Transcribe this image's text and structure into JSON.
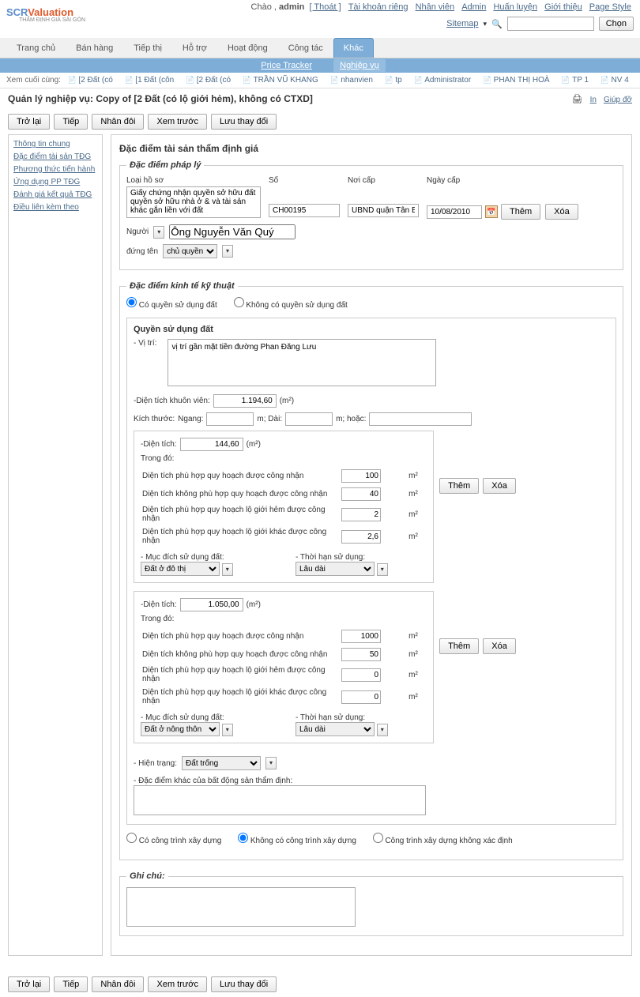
{
  "logo": {
    "part1": "SCR",
    "part2": "Valuation",
    "sub": "THẨM ĐỊNH GIÁ SÀI GÒN"
  },
  "top": {
    "greeting": "Chào , ",
    "user": "admin",
    "logout": "[ Thoát ]",
    "links": [
      "Tài khoản riêng",
      "Nhân viên",
      "Admin",
      "Huấn luyện",
      "Giới thiệu",
      "Page Style"
    ],
    "sitemap": "Sitemap",
    "search_btn": "Chọn"
  },
  "nav": [
    "Trang chủ",
    "Bán hàng",
    "Tiếp thị",
    "Hỗ trợ",
    "Hoạt động",
    "Công tác",
    "Khác"
  ],
  "subnav": [
    "Price Tracker",
    "Nghiệp vụ"
  ],
  "recents": {
    "label": "Xem cuối cùng:",
    "items": [
      "[2 Đất (có",
      "[1 Đất (côn",
      "[2 Đất (có",
      "TRẦN VŨ KHANG",
      "nhanvien",
      "tp",
      "Administrator",
      "PHAN THỊ HOÀ",
      "TP 1",
      "NV 4"
    ]
  },
  "page_title": "Quản lý nghiệp vụ: Copy of [2 Đất (có lộ giới hẻm), không có CTXD]",
  "header_right": {
    "print": "In",
    "help": "Giúp đỡ"
  },
  "buttons": [
    "Trở lại",
    "Tiếp",
    "Nhân đôi",
    "Xem trước",
    "Lưu thay đổi"
  ],
  "sidenav": [
    "Thông tin chung",
    "Đặc điểm tài sản TĐG",
    "Phương thức tiến hành",
    "Ứng dụng PP TĐG",
    "Đánh giá kết quả TĐG",
    "Điều liên kèm theo"
  ],
  "section_title": "Đặc điểm tài sản thẩm định giá",
  "legal": {
    "legend": "Đặc điểm pháp lý",
    "loai_hs": "Loại hồ sơ",
    "loai_hs_val": "Giấy chứng nhận quyền sở hữu đất quyền sở hữu nhà ở & và tài sản khác gắn liền với đất",
    "so": "Số",
    "so_val": "CH00195",
    "noicap": "Nơi cấp",
    "noicap_val": "UBND quận Tân Bình",
    "ngaycap": "Ngày cấp",
    "ngaycap_val": "10/08/2010",
    "them": "Thêm",
    "xoa": "Xóa",
    "nguoi": "Người",
    "nguoi_val": "Ông Nguyễn Văn Quý",
    "dungten": "đứng tên",
    "chuquyen": "chủ quyền"
  },
  "tech": {
    "legend": "Đặc điểm kinh tế kỹ thuật",
    "r1": "Có quyền sử dụng đất",
    "r2": "Không có quyền sử dụng đất",
    "qsd_legend": "Quyền sử dụng đất",
    "vitri": "- Vị trí:",
    "vitri_val": "vị trí gần mặt tiền đường Phan Đăng Lưu",
    "dtkv": "-Diện tích khuôn viên:",
    "dtkv_val": "1.194,60",
    "m2": "(m²)",
    "kichthuoc": "Kích thước:",
    "ngang": "Ngang:",
    "dai": "m; Dài:",
    "hoac": "m; hoặc:",
    "dientich": "-Diện tích:",
    "trongdo": "Trong đó:",
    "rows_labels": [
      "Diện tích phù hợp quy hoạch được công nhận",
      "Diện tích không phù hợp quy hoạch được công nhận",
      "Diện tích phù hợp quy hoạch lộ giới hẻm được công nhận",
      "Diện tích phù hợp quy hoạch lộ giới khác được công nhận"
    ],
    "block1": {
      "dt": "144,60",
      "vals": [
        "100",
        "40",
        "2",
        "2,6"
      ]
    },
    "block2": {
      "dt": "1.050,00",
      "vals": [
        "1000",
        "50",
        "0",
        "0"
      ]
    },
    "m2u": "m²",
    "mdsd": "- Mục đích sử dụng đất:",
    "thsd": "- Thời hạn sử dụng:",
    "mdsd1": "Đất ở đô thị",
    "mdsd2": "Đất ở nông thôn",
    "laudai": "Lâu dài",
    "hientrang": "- Hiện trạng:",
    "hientrang_val": "Đất trống",
    "dackhac": "- Đặc điểm khác của bất động sản thẩm định:"
  },
  "ctxd": {
    "o1": "Có công trình xây dựng",
    "o2": "Không có công trình xây dựng",
    "o3": "Công trình xây dựng không xác định"
  },
  "ghichu": {
    "legend": "Ghi chú:"
  }
}
